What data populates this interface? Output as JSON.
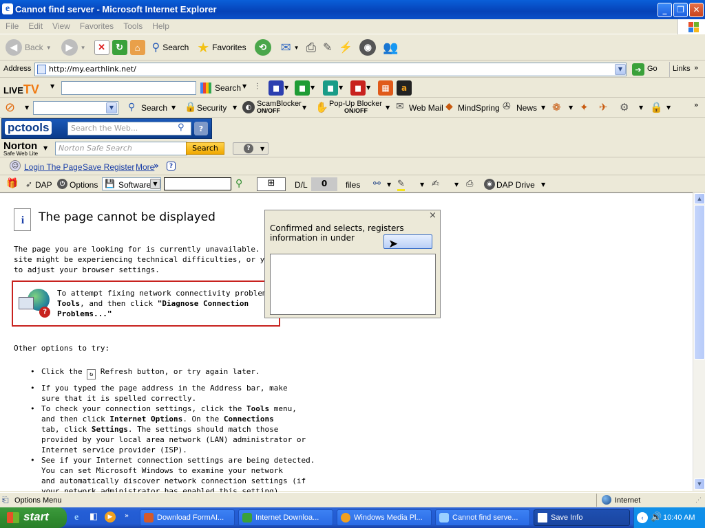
{
  "window": {
    "title": "Cannot find server - Microsoft Internet Explorer"
  },
  "menu": [
    "File",
    "Edit",
    "View",
    "Favorites",
    "Tools",
    "Help"
  ],
  "std": {
    "back": "Back",
    "search": "Search",
    "favorites": "Favorites"
  },
  "address": {
    "label": "Address",
    "url": "http://my.earthlink.net/",
    "go": "Go",
    "links": "Links"
  },
  "livetv": {
    "logo_live": "LIVE",
    "logo_tv": "TV",
    "search": "Search"
  },
  "earthlink": {
    "search": "Search",
    "security": "Security",
    "scam_top": "ScamBlocker",
    "scam_state": "ON/OFF",
    "popup_top": "Pop-Up Blocker",
    "popup_state": "ON/OFF",
    "webmail": "Web Mail",
    "mindspring": "MindSpring",
    "news": "News"
  },
  "pctools": {
    "logo": "pctools",
    "placeholder": "Search the Web..."
  },
  "norton": {
    "logo": "Norton",
    "sub": "Safe Web Lite",
    "placeholder": "Norton Safe Search",
    "search": "Search"
  },
  "links_bar": {
    "login": "Login The Page",
    "save": "Save Register",
    "more": "More"
  },
  "dap": {
    "dap": "DAP",
    "options": "Options",
    "software": "Software",
    "dl": "D/L",
    "count": "0",
    "files": "files",
    "drive": "DAP Drive"
  },
  "page": {
    "title": "The page cannot be displayed",
    "p1a": "The page you are looking for is currently unavailable. The Web",
    "p1b": "site might be experiencing technical difficulties, or you may nee",
    "p1c": "to adjust your browser settings.",
    "box1": "To attempt fixing network connectivity problems, clic",
    "box2a": "Tools",
    "box2b": ", and then click ",
    "box2c": "\"Diagnose Connection",
    "box3": "Problems...\"",
    "other": "Other options to try:",
    "b1a": "Click the",
    "b1b": "Refresh button, or try again later.",
    "b2a": "If you typed the page address in the Address bar, make",
    "b2b": "sure that it is spelled correctly.",
    "b3a": "To check your connection settings, click the ",
    "b3b": "Tools",
    "b3c": " menu,",
    "b3d": "and then click ",
    "b3e": "Internet Options",
    "b3f": ". On the ",
    "b3g": "Connections",
    "b3h": "tab, click ",
    "b3i": "Settings",
    "b3j": ". The settings should match those",
    "b3k": "provided by your local area network (LAN) administrator or",
    "b3l": "Internet service provider (ISP).",
    "b4a": "See if your Internet connection settings are being detected.",
    "b4b": "You can set Microsoft Windows to examine your network",
    "b4c": "and automatically discover network connection settings (if",
    "b4d": "your network administrator has enabled this setting)."
  },
  "dialog": {
    "line1": "Confirmed and selects, registers",
    "line2": "information in under",
    "close": "×"
  },
  "status": {
    "left": "Options Menu",
    "zone": "Internet"
  },
  "taskbar": {
    "start": "start",
    "buttons": [
      "Download FormAI...",
      "Internet Downloa...",
      "Windows Media Pl...",
      "Cannot find serve...",
      "Save Info"
    ],
    "clock": "10:40 AM"
  }
}
